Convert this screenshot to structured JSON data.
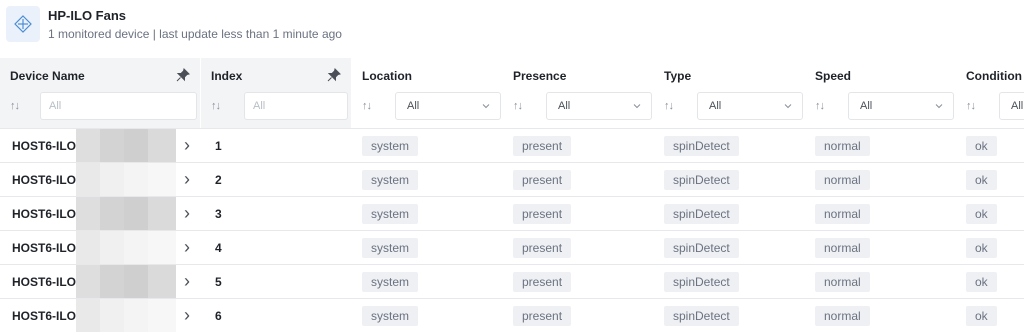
{
  "header": {
    "title": "HP-ILO Fans",
    "subtitle": "1 monitored device | last update less than 1 minute ago",
    "icon": "fan-widget-icon"
  },
  "columns": [
    {
      "label": "Device Name",
      "filter_type": "text",
      "placeholder": "All",
      "pinned": true
    },
    {
      "label": "Index",
      "filter_type": "text",
      "placeholder": "All",
      "pinned": true
    },
    {
      "label": "Location",
      "filter_type": "select",
      "value": "All"
    },
    {
      "label": "Presence",
      "filter_type": "select",
      "value": "All"
    },
    {
      "label": "Type",
      "filter_type": "select",
      "value": "All"
    },
    {
      "label": "Speed",
      "filter_type": "select",
      "value": "All"
    },
    {
      "label": "Condition",
      "filter_type": "select",
      "value": "All"
    }
  ],
  "sort_icon": "↑↓",
  "rows": [
    {
      "device": "HOST6-ILO",
      "index": "1",
      "location": "system",
      "presence": "present",
      "type": "spinDetect",
      "speed": "normal",
      "condition": "ok"
    },
    {
      "device": "HOST6-ILO",
      "index": "2",
      "location": "system",
      "presence": "present",
      "type": "spinDetect",
      "speed": "normal",
      "condition": "ok"
    },
    {
      "device": "HOST6-ILO",
      "index": "3",
      "location": "system",
      "presence": "present",
      "type": "spinDetect",
      "speed": "normal",
      "condition": "ok"
    },
    {
      "device": "HOST6-ILO",
      "index": "4",
      "location": "system",
      "presence": "present",
      "type": "spinDetect",
      "speed": "normal",
      "condition": "ok"
    },
    {
      "device": "HOST6-ILO",
      "index": "5",
      "location": "system",
      "presence": "present",
      "type": "spinDetect",
      "speed": "normal",
      "condition": "ok"
    },
    {
      "device": "HOST6-ILO",
      "index": "6",
      "location": "system",
      "presence": "present",
      "type": "spinDetect",
      "speed": "normal",
      "condition": "ok"
    }
  ],
  "colors": {
    "pinned_header_bg": "#f3f4f6",
    "tag_bg": "#eef0f3",
    "icon_accent": "#4a8ed6"
  }
}
